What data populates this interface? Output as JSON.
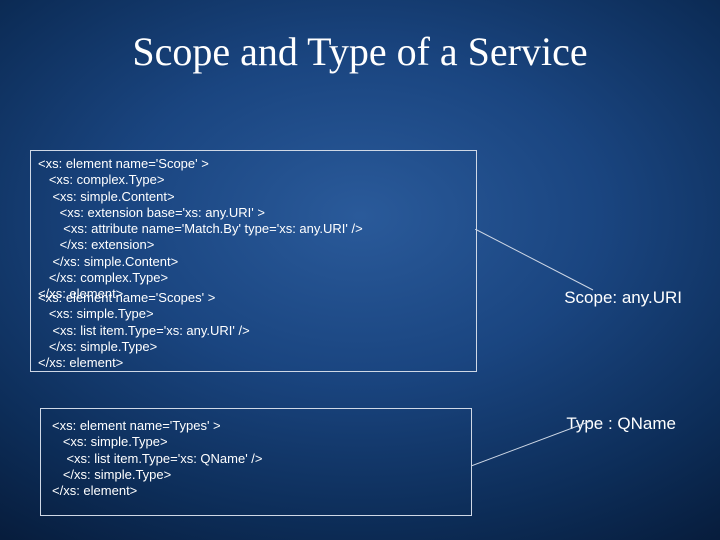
{
  "title": "Scope and Type of a Service",
  "codeBlock1": "<xs: element name='Scope' >\n   <xs: complex.Type>\n    <xs: simple.Content>\n      <xs: extension base='xs: any.URI' >\n       <xs: attribute name='Match.By' type='xs: any.URI' />\n      </xs: extension>\n    </xs: simple.Content>\n   </xs: complex.Type>\n</xs: element>",
  "codeBlock2": "<xs: element name='Scopes' >\n   <xs: simple.Type>\n    <xs: list item.Type='xs: any.URI' />\n   </xs: simple.Type>\n</xs: element>",
  "codeBlock3": "<xs: element name='Types' >\n   <xs: simple.Type>\n    <xs: list item.Type='xs: QName' />\n   </xs: simple.Type>\n</xs: element>",
  "labelScope": "Scope: any.URI",
  "labelType": "Type : QName"
}
